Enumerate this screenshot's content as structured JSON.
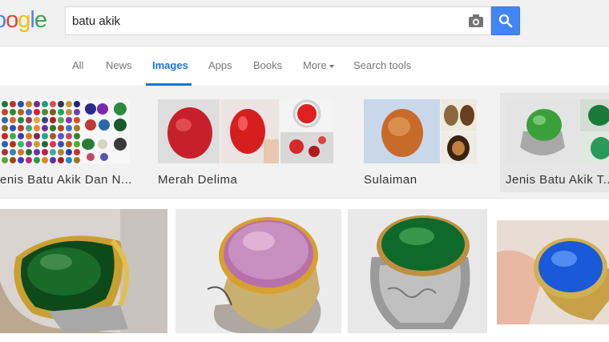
{
  "search": {
    "query": "batu akik",
    "logo_text": "oogle"
  },
  "tabs": [
    {
      "label": "All"
    },
    {
      "label": "News"
    },
    {
      "label": "Images"
    },
    {
      "label": "Apps"
    },
    {
      "label": "Books"
    },
    {
      "label": "More"
    },
    {
      "label": "Search tools"
    }
  ],
  "related": [
    {
      "label": "enis Batu Akik Dan N..."
    },
    {
      "label": "Merah Delima"
    },
    {
      "label": "Sulaiman"
    },
    {
      "label": "Jenis Batu Akik T..."
    }
  ],
  "colors": {
    "accent": "#4285f4",
    "active_tab": "#1a73e8"
  },
  "icons": [
    "camera-icon",
    "search-icon",
    "caret-down-icon"
  ]
}
